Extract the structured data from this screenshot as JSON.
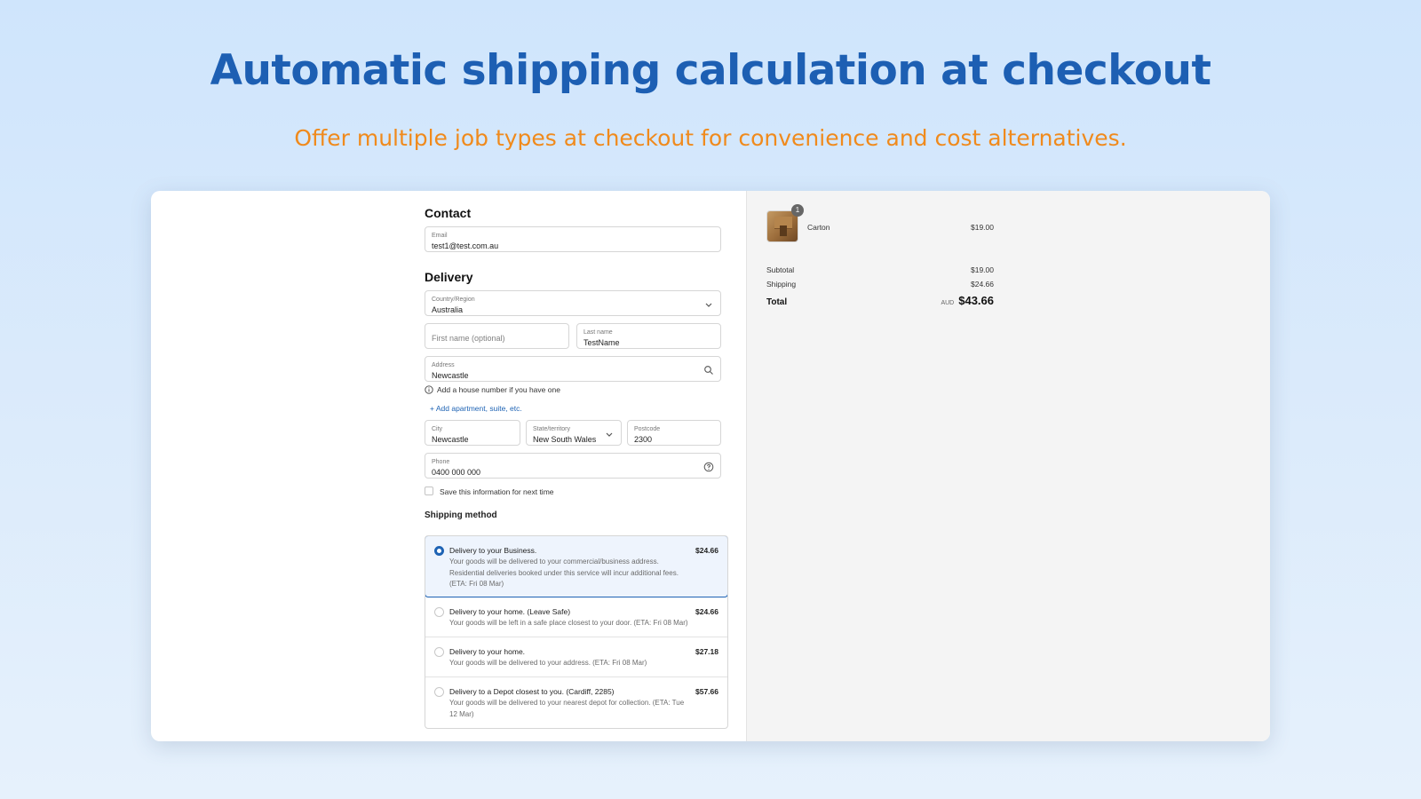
{
  "hero": {
    "title": "Automatic shipping calculation at checkout",
    "subtitle": "Offer multiple job types at checkout for convenience and cost alternatives."
  },
  "contact": {
    "title": "Contact",
    "email_label": "Email",
    "email_value": "test1@test.com.au"
  },
  "delivery": {
    "title": "Delivery",
    "country_label": "Country/Region",
    "country_value": "Australia",
    "first_name_placeholder": "First name (optional)",
    "last_name_label": "Last name",
    "last_name_value": "TestName",
    "address_label": "Address",
    "address_value": "Newcastle",
    "address_hint": "Add a house number if you have one",
    "add_apartment": "+ Add apartment, suite, etc.",
    "city_label": "City",
    "city_value": "Newcastle",
    "state_label": "State/territory",
    "state_value": "New South Wales",
    "postcode_label": "Postcode",
    "postcode_value": "2300",
    "phone_label": "Phone",
    "phone_value": "0400 000 000",
    "save_info": "Save this information for next time"
  },
  "shipping": {
    "title": "Shipping method",
    "options": [
      {
        "title": "Delivery to your Business.",
        "price": "$24.66",
        "desc": "Your goods will be delivered to your commercial/business address. Residential deliveries booked under this service will incur additional fees. (ETA: Fri 08 Mar)",
        "selected": true
      },
      {
        "title": "Delivery to your home. (Leave Safe)",
        "price": "$24.66",
        "desc": "Your goods will be left in a safe place closest to your door. (ETA: Fri 08 Mar)",
        "selected": false
      },
      {
        "title": "Delivery to your home.",
        "price": "$27.18",
        "desc": "Your goods will be delivered to your address. (ETA: Fri 08 Mar)",
        "selected": false
      },
      {
        "title": "Delivery to a Depot closest to you. (Cardiff, 2285)",
        "price": "$57.66",
        "desc": "Your goods will be delivered to your nearest depot for collection. (ETA: Tue 12 Mar)",
        "selected": false
      }
    ]
  },
  "summary": {
    "item_name": "Carton",
    "item_qty": "1",
    "item_price": "$19.00",
    "subtotal_label": "Subtotal",
    "subtotal_value": "$19.00",
    "shipping_label": "Shipping",
    "shipping_value": "$24.66",
    "total_label": "Total",
    "currency": "AUD",
    "total_value": "$43.66"
  },
  "colors": {
    "title": "#1d5fb3",
    "subtitle": "#f08a1c",
    "accent": "#1e63b4"
  },
  "icons": [
    "chevron-down-icon",
    "search-icon",
    "info-icon",
    "help-icon",
    "carton-thumbnail"
  ]
}
